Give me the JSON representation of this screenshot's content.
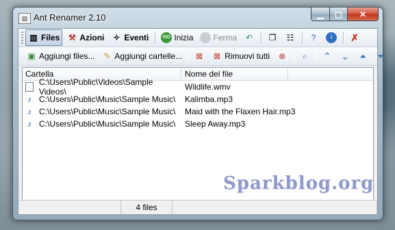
{
  "window": {
    "title": "Ant Renamer 2.10"
  },
  "toolbar1": {
    "files": "Files",
    "azioni": "Azioni",
    "eventi": "Eventi",
    "inizia": "Inizia",
    "ferma": "Ferma"
  },
  "toolbar2": {
    "aggiungi_files": "Aggiungi files...",
    "aggiungi_cartelle": "Aggiungi cartelle...",
    "rimuovi_tutti": "Rimuovi tutti"
  },
  "list": {
    "headers": [
      "Cartella",
      "Nome del file"
    ],
    "rows": [
      {
        "folder": "C:\\Users\\Public\\Videos\\Sample Videos\\",
        "file": "Wildlife.wmv",
        "icon": "video-file-icon"
      },
      {
        "folder": "C:\\Users\\Public\\Music\\Sample Music\\",
        "file": "Kalimba.mp3",
        "icon": "music-file-icon"
      },
      {
        "folder": "C:\\Users\\Public\\Music\\Sample Music\\",
        "file": "Maid with the Flaxen Hair.mp3",
        "icon": "music-file-icon"
      },
      {
        "folder": "C:\\Users\\Public\\Music\\Sample Music\\",
        "file": "Sleep Away.mp3",
        "icon": "music-file-icon"
      }
    ]
  },
  "status": {
    "count": "4 files"
  },
  "watermark": "Sparkblog.org",
  "colors": {
    "accent_blue": "#2f6fc0",
    "close_red": "#c2351b",
    "go_green": "#3a9a3a"
  }
}
